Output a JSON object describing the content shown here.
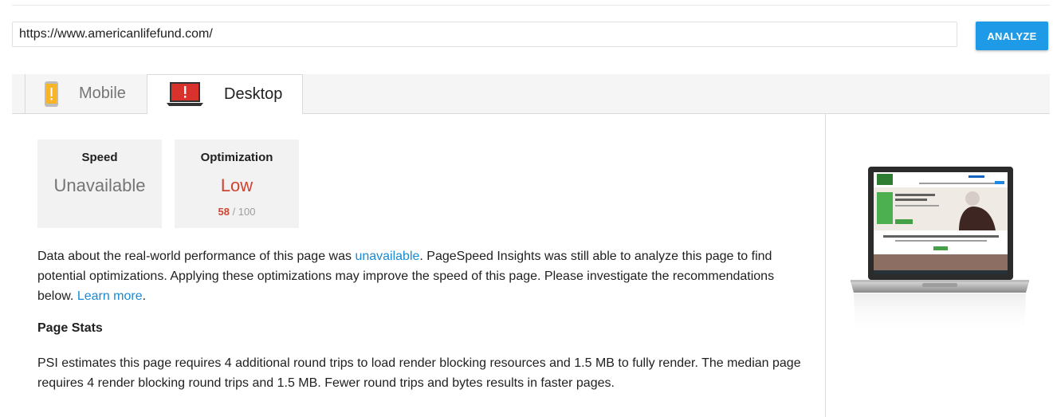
{
  "search": {
    "url_value": "https://www.americanlifefund.com/",
    "analyze_label": "ANALYZE"
  },
  "tabs": [
    {
      "label": "Mobile",
      "active": false,
      "icon": "mobile-phone-warning-icon",
      "icon_color": "#f9b52a"
    },
    {
      "label": "Desktop",
      "active": true,
      "icon": "laptop-warning-icon",
      "icon_color": "#d9312b"
    }
  ],
  "scores": {
    "speed": {
      "title": "Speed",
      "value": "Unavailable",
      "color": "#757575"
    },
    "optimization": {
      "title": "Optimization",
      "value": "Low",
      "color": "#d04432",
      "score": "58",
      "max": "/ 100"
    }
  },
  "content": {
    "intro": {
      "part1": "Data about the real-world performance of this page was ",
      "link1": "unavailable",
      "part2": ". PageSpeed Insights was still able to analyze this page to find potential optimizations. Applying these optimizations may improve the speed of this page. Please investigate the recommendations below. ",
      "link2": "Learn more",
      "part3": "."
    },
    "page_stats_heading": "Page Stats",
    "page_stats_text": "PSI estimates this page requires 4 additional round trips to load render blocking resources and 1.5 MB to fully render. The median page requires 4 render blocking round trips and 1.5 MB. Fewer round trips and bytes results in faster pages."
  },
  "colors": {
    "accent": "#1e9ae6",
    "link": "#1a8bd3",
    "low": "#d04432"
  }
}
